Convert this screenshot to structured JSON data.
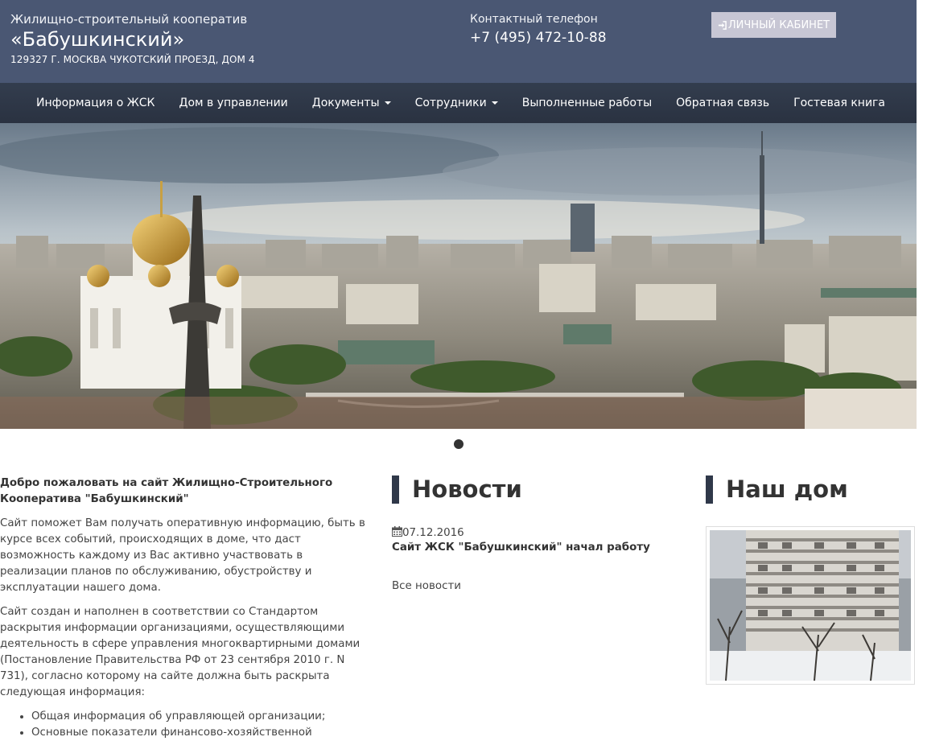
{
  "header": {
    "coop_line": "Жилищно-строительный кооператив",
    "coop_name": "«Бабушкинский»",
    "address": "129327 Г. МОСКВА ЧУКОТСКИЙ ПРОЕЗД, ДОМ 4",
    "contact_label": "Контактный телефон",
    "contact_phone": "+7 (495) 472-10-88",
    "cabinet_button": "ЛИЧНЫЙ КАБИНЕТ",
    "cabinet_icon": "sign-in-icon"
  },
  "nav": {
    "items": [
      {
        "label": "Информация о ЖСК"
      },
      {
        "label": "Дом в управлении"
      },
      {
        "label": "Документы",
        "dropdown": true
      },
      {
        "label": "Сотрудники",
        "dropdown": true
      },
      {
        "label": "Выполненные работы"
      },
      {
        "label": "Обратная связь"
      },
      {
        "label": "Гостевая книга"
      }
    ]
  },
  "carousel": {
    "slides_count": 1,
    "active_index": 0
  },
  "welcome": {
    "title": "Добро пожаловать на сайт Жилищно-Строительного Кооператива \"Бабушкинский\"",
    "paragraph1": "Сайт поможет Вам получать оперативную информацию, быть в курсе всех событий, происходящих в доме, что даст возможность каждому из Вас активно участвовать в реализации планов по обслуживанию, обустройству и эксплуатации нашего дома.",
    "paragraph2": "Сайт создан и наполнен в соответствии со Стандартом раскрытия информации организациями, осуществляющими деятельность в сфере управления многоквартирными домами (Постановление Правительства РФ от 23 сентября 2010 г. N 731), согласно которому на сайте должна быть раскрыта следующая информация:",
    "list": [
      "Общая информация об управляющей организации;",
      "Основные показатели финансово-хозяйственной"
    ]
  },
  "news": {
    "title": "Новости",
    "date": "07.12.2016",
    "date_icon": "calendar-icon",
    "item_title": "Сайт ЖСК \"Бабушкинский\" начал работу",
    "all_news": "Все новости"
  },
  "house": {
    "title": "Наш дом"
  },
  "colors": {
    "header_bg": "#4a5773",
    "navbar_bg": "#2e3646",
    "button_bg": "#c7c6d4",
    "accent_bar": "#2f3849"
  }
}
